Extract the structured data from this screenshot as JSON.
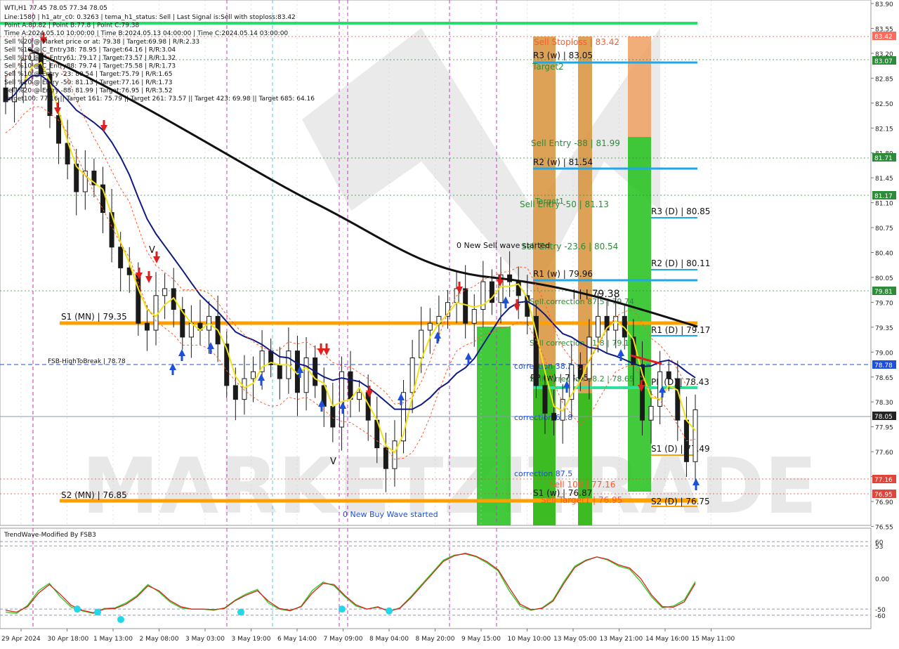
{
  "chart_data": {
    "type": "candlestick",
    "symbol": "WTI,H1",
    "ohlc_header": "77.45 78.05 77.34 78.05",
    "info_lines": [
      "Line:1580 | h1_atr_c0: 0.3263 | tema_h1_status: Sell | Last Signal is:Sell with stoploss:83.42",
      "Point A:80.82 | Point B:77.8 | Point C:79.38",
      "Time A:2024.05.10 10:00:00 | Time B:2024.05.13 04:00:00 | Time C:2024.05.14 03:00:00",
      "Sell %20 @ Market price or at: 79.38 | Target:69.98 | R/R:2.33",
      "Sell %10 @ C_Entry38: 78.95 | Target:64.16 | R/R:3.04",
      "Sell %10 @ C_Entry61: 79.17 | Target:73.57 | R/R:1.32",
      "Sell %10 @ C_Entry88: 79.74 | Target:75.58 | R/R:1.73",
      "Sell %10 @ Entry -23: 80.54 | Target:75.79 | R/R:1.65",
      "Sell %20 @ Entry -50: 81.13 | Target:77.16 | R/R:1.73",
      "Sell %20 @ Entry -88: 81.99 | Target:76.95 | R/R:3.52",
      "Target100: 77.16 || Target 161: 75.79 || Target 261: 73.57 || Target 423: 69.98 || Target 685: 64.16"
    ],
    "y_axis": {
      "min": 76.4,
      "max": 83.95,
      "ticks": [
        "83.90",
        "83.55",
        "83.20",
        "82.85",
        "82.50",
        "82.15",
        "81.80",
        "81.45",
        "81.10",
        "80.75",
        "80.40",
        "80.05",
        "79.70",
        "79.35",
        "79.00",
        "78.65",
        "78.30",
        "77.95",
        "77.60",
        "77.25",
        "76.90",
        "76.55"
      ]
    },
    "x_axis_labels": [
      "29 Apr 2024",
      "30 Apr 18:00",
      "1 May 13:00",
      "2 May 08:00",
      "3 May 03:00",
      "3 May 19:00",
      "6 May 14:00",
      "7 May 09:00",
      "8 May 04:00",
      "8 May 20:00",
      "9 May 15:00",
      "10 May 10:00",
      "13 May 05:00",
      "13 May 21:00",
      "14 May 16:00",
      "15 May 11:00"
    ],
    "price_badges": [
      {
        "value": "83.42",
        "color": "#ff6a5a"
      },
      {
        "value": "83.07",
        "color": "#2e8b3a"
      },
      {
        "value": "81.71",
        "color": "#2e8b3a"
      },
      {
        "value": "81.17",
        "color": "#2e8b3a"
      },
      {
        "value": "79.81",
        "color": "#2e8b3a"
      },
      {
        "value": "78.78",
        "color": "#1e4fd8"
      },
      {
        "value": "78.05",
        "color": "#222222"
      },
      {
        "value": "77.16",
        "color": "#e0453a"
      },
      {
        "value": "76.95",
        "color": "#e0453a"
      }
    ],
    "levels": [
      {
        "label": "S1 (MN) | 79.35",
        "price": 79.35,
        "color": "#ff9f00",
        "type": "monthly"
      },
      {
        "label": "S2 (MN) | 76.85",
        "price": 76.85,
        "color": "#ff9f00",
        "type": "monthly"
      },
      {
        "label": "FSB-HighToBreak | 78.78",
        "price": 78.78,
        "color": "#1e4fd8",
        "type": "dashed"
      },
      {
        "label": "R3 (w) | 83.05",
        "price": 83.05,
        "color": "#1fa7e8",
        "type": "weekly"
      },
      {
        "label": "R2 (w) | 81.54",
        "price": 81.54,
        "color": "#1fa7e8",
        "type": "weekly"
      },
      {
        "label": "R1 (w) | 79.96",
        "price": 79.96,
        "color": "#1fa7e8",
        "type": "weekly"
      },
      {
        "label": "PP (w) | 78.45",
        "price": 78.45,
        "color": "#2ee09a",
        "type": "weekly"
      },
      {
        "label": "S1 (w) | 76.87",
        "price": 76.87,
        "color": "#ff9f00",
        "type": "weekly"
      },
      {
        "label": "R3 (D) | 80.85",
        "price": 80.85,
        "color": "#1fa7e8",
        "type": "daily"
      },
      {
        "label": "R2 (D) | 80.11",
        "price": 80.11,
        "color": "#1fa7e8",
        "type": "daily"
      },
      {
        "label": "R1 (D) | 79.17",
        "price": 79.17,
        "color": "#1fa7e8",
        "type": "daily"
      },
      {
        "label": "PP (D) | 78.43",
        "price": 78.43,
        "color": "#2ee09a",
        "type": "daily"
      },
      {
        "label": "S1 (D) | 77.49",
        "price": 77.49,
        "color": "#ff9f00",
        "type": "daily"
      },
      {
        "label": "S2 (D) | 76.75",
        "price": 76.75,
        "color": "#ff9f00",
        "type": "daily"
      }
    ],
    "annotations": [
      {
        "text": "Sell Stoploss | 83.42",
        "color": "#ff5a2a"
      },
      {
        "text": "Target2",
        "color": "#2e8b3a"
      },
      {
        "text": "Sell Entry -88 | 81.99",
        "color": "#2e8b3a"
      },
      {
        "text": "Target1",
        "color": "#2e8b3a"
      },
      {
        "text": "Sell Entry -50 | 81.13",
        "color": "#2e8b3a"
      },
      {
        "text": "Sell Entry -23.6 | 80.54",
        "color": "#2e8b3a"
      },
      {
        "text": "0 New Sell wave started",
        "color": "#111111"
      },
      {
        "text": "| | | 79.38",
        "color": "#111111"
      },
      {
        "text": "Sell correction 87.5 | 79.74",
        "color": "#2e8b3a"
      },
      {
        "text": "Sell correction 61.8 | 79.17",
        "color": "#2e8b3a"
      },
      {
        "text": "correction 38.2",
        "color": "#1e4fd8"
      },
      {
        "text": "Sell correction 38.2 | 78.65",
        "color": "#2e8b3a"
      },
      {
        "text": "correction 61.8",
        "color": "#1e4fd8"
      },
      {
        "text": "correction 87.5",
        "color": "#1e4fd8"
      },
      {
        "text": "Sell 100 | 77.16",
        "color": "#ff5a2a"
      },
      {
        "text": "Sell Target1 | 76.95",
        "color": "#ff5a2a"
      },
      {
        "text": "0 New Buy Wave started",
        "color": "#1e4fd8"
      },
      {
        "text": "V",
        "color": "#111111"
      },
      {
        "text": "V",
        "color": "#111111"
      }
    ],
    "watermark": "MARKETZITRADE",
    "series": [
      {
        "name": "close",
        "values": [
          82.5,
          82.7,
          83.1,
          83.2,
          82.9,
          82.3,
          81.9,
          81.6,
          81.2,
          81.5,
          81.3,
          80.9,
          80.4,
          80.1,
          80.0,
          79.3,
          79.2,
          79.7,
          79.8,
          79.5,
          79.1,
          79.3,
          79.2,
          79.4,
          79.0,
          78.4,
          78.2,
          78.5,
          78.6,
          78.9,
          78.7,
          78.5,
          78.9,
          78.3,
          78.8,
          78.4,
          78.1,
          77.8,
          78.6,
          78.2,
          78.3,
          77.9,
          77.5,
          77.2,
          77.6,
          78.3,
          78.8,
          79.2,
          79.3,
          79.4,
          79.6,
          79.8,
          79.3,
          79.5,
          79.9,
          79.6,
          80.0,
          79.9,
          79.7,
          79.4,
          78.4,
          78.0,
          77.9,
          78.2,
          78.7,
          78.5,
          79.1,
          79.4,
          79.2,
          79.4,
          79.1,
          78.7,
          77.9,
          78.1,
          78.6,
          78.5,
          77.9,
          77.3,
          78.05
        ]
      }
    ],
    "oscillator": {
      "title": "TrendWave-Modified By FSB3",
      "y_ticks": [
        "60",
        "53",
        "0.00",
        "-50",
        "-60"
      ],
      "y_min": -75,
      "y_max": 75,
      "levels": [
        60,
        53,
        -50,
        -60
      ],
      "green": [
        -55,
        -57,
        -44,
        -20,
        -8,
        -30,
        -47,
        -53,
        -57,
        -49,
        -48,
        -40,
        -28,
        -10,
        -22,
        -38,
        -48,
        -50,
        -50,
        -52,
        -48,
        -35,
        -25,
        -18,
        -40,
        -50,
        -53,
        -45,
        -20,
        -6,
        -12,
        -30,
        -45,
        -50,
        -46,
        -54,
        -48,
        -30,
        -10,
        10,
        30,
        38,
        40,
        35,
        25,
        12,
        -20,
        -45,
        -52,
        -48,
        -35,
        -5,
        20,
        30,
        35,
        30,
        20,
        15,
        -5,
        -30,
        -48,
        -45,
        -35,
        -5
      ],
      "red": [
        -52,
        -55,
        -46,
        -24,
        -10,
        -26,
        -44,
        -52,
        -56,
        -50,
        -49,
        -42,
        -30,
        -12,
        -20,
        -36,
        -46,
        -50,
        -50,
        -51,
        -49,
        -36,
        -27,
        -20,
        -37,
        -49,
        -52,
        -46,
        -24,
        -8,
        -10,
        -28,
        -43,
        -50,
        -47,
        -53,
        -49,
        -32,
        -12,
        8,
        28,
        37,
        41,
        36,
        27,
        14,
        -15,
        -42,
        -51,
        -49,
        -37,
        -8,
        18,
        29,
        35,
        31,
        22,
        17,
        0,
        -27,
        -46,
        -47,
        -38,
        -8
      ],
      "markers": [
        {
          "i": 8,
          "v": -50
        },
        {
          "i": 10,
          "v": -55
        },
        {
          "i": 13,
          "v": -67
        },
        {
          "i": 22,
          "v": -55
        },
        {
          "i": 32,
          "v": -50
        },
        {
          "i": 36,
          "v": -53
        }
      ]
    }
  }
}
